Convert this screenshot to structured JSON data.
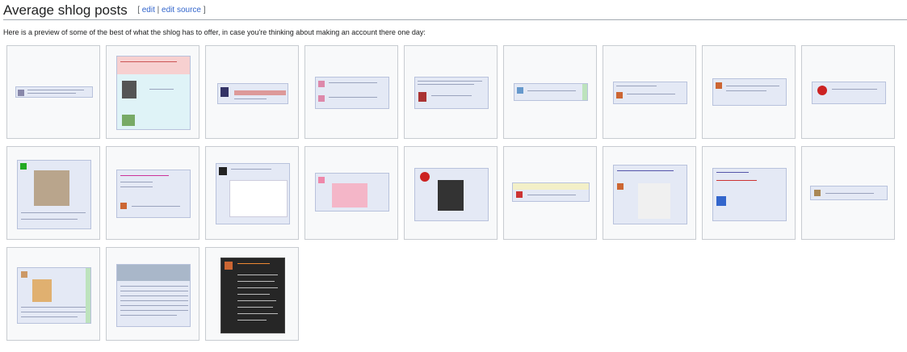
{
  "section": {
    "title": "Average shlog posts",
    "edit_open": "[",
    "edit_label": "edit",
    "edit_sep": "|",
    "edit_source_label": "edit source",
    "edit_close": "]"
  },
  "intro_text": "Here is a preview of some of the best of what the shlog has to offer, in case you're thinking about making an account there one day:",
  "gallery": {
    "image_count": 21
  }
}
